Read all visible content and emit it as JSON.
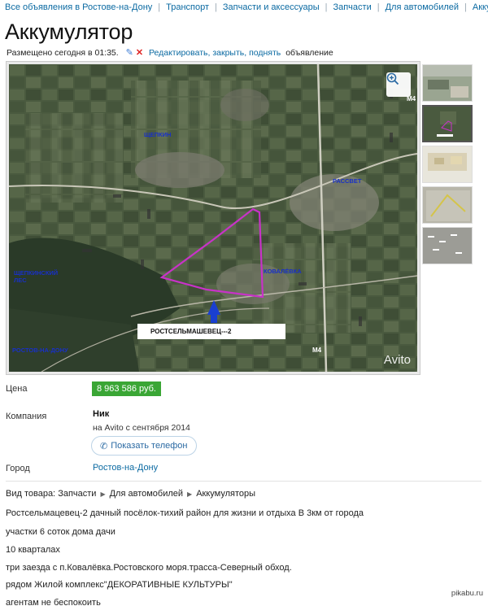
{
  "breadcrumbs": [
    "Все объявления в Ростове-на-Дону",
    "Транспорт",
    "Запчасти и аксессуары",
    "Запчасти",
    "Для автомобилей",
    "Аккумул"
  ],
  "title": "Аккумулятор",
  "posted": {
    "text": "Размещено сегодня в 01:35.",
    "edit_link": "Редактировать, закрыть, поднять",
    "tail": "объявление"
  },
  "map": {
    "labels": [
      "ЩЕПКИН",
      "РАССВЕТ",
      "ЩЕПКИНСКИЙ ЛЕС",
      "КОВАЛЁВКА",
      "РОСТОВ-НА-ДОНУ",
      "М4",
      "М4"
    ],
    "callout": "РОСТСЕЛЬМАШЕВЕЦ---2",
    "watermark": "Avito"
  },
  "details": {
    "price_label": "Цена",
    "price": "8 963 586 руб.",
    "company_label": "Компания",
    "company_name": "Ник",
    "company_since": "на Avito с сентября 2014",
    "phone_button": "Показать телефон",
    "city_label": "Город",
    "city": "Ростов-на-Дону"
  },
  "category": {
    "prefix": "Вид товара:",
    "items": [
      "Запчасти",
      "Для автомобилей",
      "Аккумуляторы"
    ]
  },
  "description": [
    "Ростсельмацевец-2 дачный посёлок-тихий район для жизни и отдыха В 3км от города",
    "участки 6 соток дома дачи",
    "10 кварталах",
    "три заезда с п.Ковалёвка.Ростовского моря.трасса-Северный обход.",
    "рядом Жилой комплекс\"ДЕКОРАТИВНЫЕ КУЛЬТУРЫ\"",
    "агентам не беспокоить"
  ],
  "source": "pikabu.ru",
  "colors": {
    "link": "#0b6aa2",
    "price_bg": "#3aa635",
    "polygon": "#c832c8"
  }
}
